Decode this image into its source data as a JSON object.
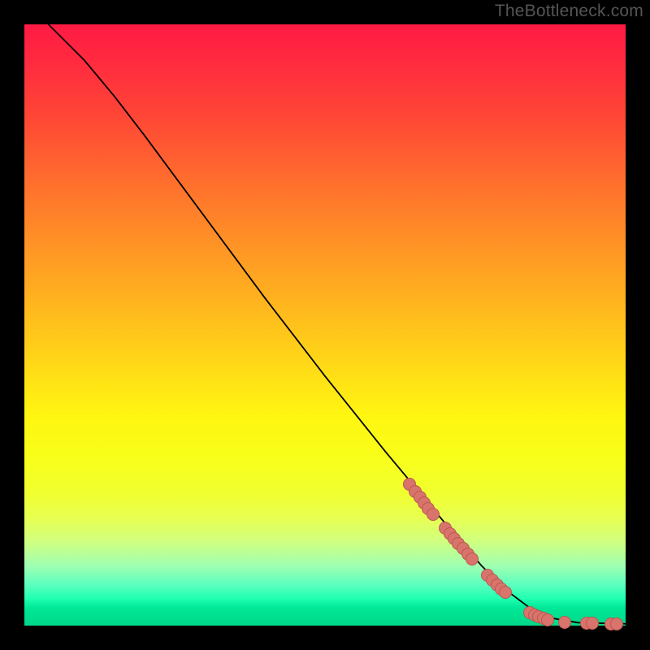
{
  "watermark": "TheBottleneck.com",
  "chart_data": {
    "type": "line",
    "title": "",
    "xlabel": "",
    "ylabel": "",
    "xlim": [
      0,
      100
    ],
    "ylim": [
      0,
      100
    ],
    "curve": [
      {
        "x": 4,
        "y": 100
      },
      {
        "x": 6,
        "y": 98
      },
      {
        "x": 10,
        "y": 94
      },
      {
        "x": 15,
        "y": 88
      },
      {
        "x": 20,
        "y": 81.5
      },
      {
        "x": 30,
        "y": 68
      },
      {
        "x": 40,
        "y": 54.5
      },
      {
        "x": 50,
        "y": 41.5
      },
      {
        "x": 60,
        "y": 29
      },
      {
        "x": 70,
        "y": 17
      },
      {
        "x": 76,
        "y": 10
      },
      {
        "x": 80,
        "y": 6
      },
      {
        "x": 84,
        "y": 3
      },
      {
        "x": 88,
        "y": 1.2
      },
      {
        "x": 92,
        "y": 0.5
      },
      {
        "x": 100,
        "y": 0.3
      }
    ],
    "markers": [
      {
        "x": 64,
        "y": 23.5
      },
      {
        "x": 65,
        "y": 22.3
      },
      {
        "x": 65.8,
        "y": 21.3
      },
      {
        "x": 66.5,
        "y": 20.4
      },
      {
        "x": 67.2,
        "y": 19.5
      },
      {
        "x": 68,
        "y": 18.5
      },
      {
        "x": 70,
        "y": 16.2
      },
      {
        "x": 70.8,
        "y": 15.3
      },
      {
        "x": 71.5,
        "y": 14.5
      },
      {
        "x": 72.2,
        "y": 13.7
      },
      {
        "x": 73,
        "y": 12.8
      },
      {
        "x": 73.8,
        "y": 11.9
      },
      {
        "x": 74.5,
        "y": 11.1
      },
      {
        "x": 77,
        "y": 8.4
      },
      {
        "x": 77.8,
        "y": 7.6
      },
      {
        "x": 78.6,
        "y": 6.8
      },
      {
        "x": 79.3,
        "y": 6.1
      },
      {
        "x": 80,
        "y": 5.5
      },
      {
        "x": 84,
        "y": 2.2
      },
      {
        "x": 84.8,
        "y": 1.8
      },
      {
        "x": 85.5,
        "y": 1.5
      },
      {
        "x": 86.3,
        "y": 1.2
      },
      {
        "x": 87,
        "y": 1.0
      },
      {
        "x": 89.8,
        "y": 0.6
      },
      {
        "x": 93.5,
        "y": 0.4
      },
      {
        "x": 94.5,
        "y": 0.4
      },
      {
        "x": 97.5,
        "y": 0.3
      },
      {
        "x": 98.5,
        "y": 0.3
      }
    ]
  }
}
